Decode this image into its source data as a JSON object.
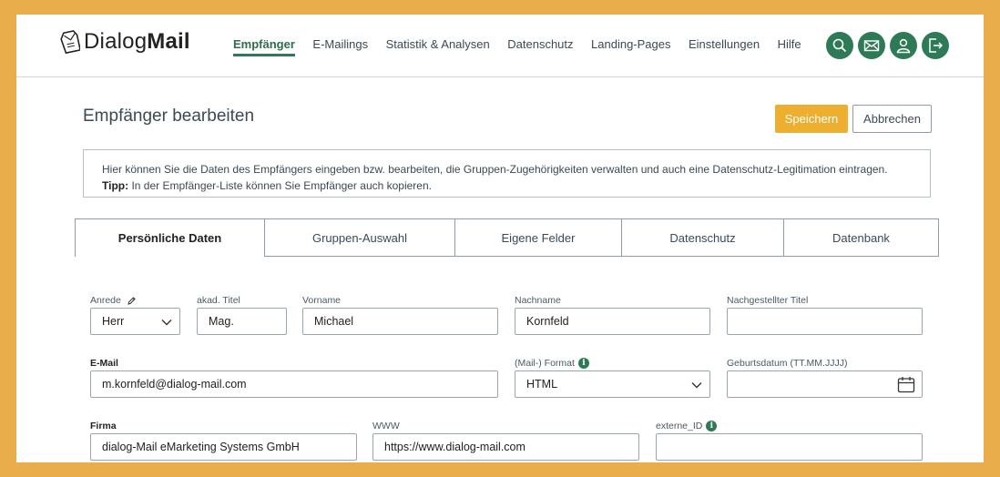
{
  "header": {
    "logo": {
      "prefix": "Dialog",
      "bold": "Mail"
    },
    "nav": [
      {
        "label": "Empfänger",
        "active": true
      },
      {
        "label": "E-Mailings"
      },
      {
        "label": "Statistik & Analysen"
      },
      {
        "label": "Datenschutz"
      },
      {
        "label": "Landing-Pages"
      },
      {
        "label": "Einstellungen"
      },
      {
        "label": "Hilfe"
      }
    ],
    "icons": [
      "search-icon",
      "mail-icon",
      "user-icon",
      "logout-icon"
    ],
    "accent": "#2f7a56"
  },
  "page": {
    "title": "Empfänger bearbeiten",
    "save_label": "Speichern",
    "cancel_label": "Abbrechen",
    "info_text": "Hier können Sie die Daten des Empfängers eingeben bzw. bearbeiten, die Gruppen-Zugehörigkeiten verwalten und auch eine Datenschutz-Legitimation eintragen.",
    "tip_label": "Tipp:",
    "tip_text": "In der Empfänger-Liste können Sie Empfänger auch kopieren."
  },
  "tabs": [
    {
      "label": "Persönliche Daten",
      "active": true
    },
    {
      "label": "Gruppen-Auswahl"
    },
    {
      "label": "Eigene Felder"
    },
    {
      "label": "Datenschutz"
    },
    {
      "label": "Datenbank"
    }
  ],
  "form": {
    "anrede": {
      "label": "Anrede",
      "value": "Herr"
    },
    "titel": {
      "label": "akad. Titel",
      "value": "Mag."
    },
    "vorname": {
      "label": "Vorname",
      "value": "Michael"
    },
    "nachname": {
      "label": "Nachname",
      "value": "Kornfeld"
    },
    "nachgestellter_titel": {
      "label": "Nachgestellter Titel",
      "value": ""
    },
    "email": {
      "label": "E-Mail",
      "value": "m.kornfeld@dialog-mail.com"
    },
    "format": {
      "label": "(Mail-) Format",
      "value": "HTML"
    },
    "geburtsdatum": {
      "label": "Geburtsdatum (TT.MM.JJJJ)",
      "value": ""
    },
    "firma": {
      "label": "Firma",
      "value": "dialog-Mail eMarketing Systems GmbH"
    },
    "www": {
      "label": "WWW",
      "value": "https://www.dialog-mail.com"
    },
    "externe_id": {
      "label": "externe_ID",
      "value": ""
    }
  },
  "colors": {
    "background": "#e9ad4c",
    "save_button": "#eeae2f",
    "accent": "#2f7a56"
  }
}
